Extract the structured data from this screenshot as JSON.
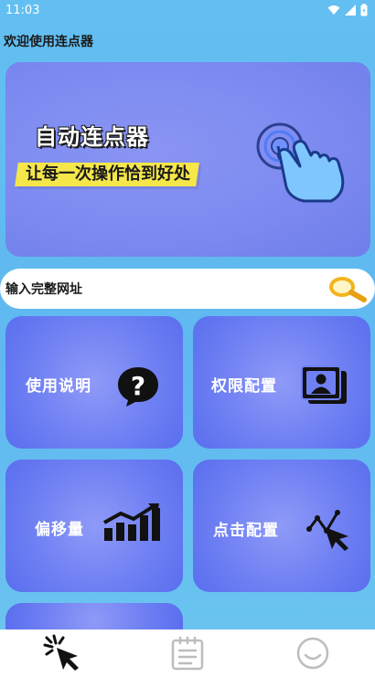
{
  "status_bar": {
    "time": "11:03"
  },
  "header": {
    "title": "欢迎使用连点器"
  },
  "banner": {
    "title": "自动连点器",
    "subtitle": "让每一次操作恰到好处"
  },
  "search": {
    "placeholder": "输入完整网址"
  },
  "cards": [
    {
      "label": "使用说明",
      "icon": "question-icon"
    },
    {
      "label": "权限配置",
      "icon": "profile-card-icon"
    },
    {
      "label": "偏移量",
      "icon": "bar-chart-icon"
    },
    {
      "label": "点击配置",
      "icon": "click-path-icon"
    }
  ],
  "bottom_nav": [
    {
      "icon": "click-cursor-icon",
      "active": true
    },
    {
      "icon": "notepad-icon",
      "active": false
    },
    {
      "icon": "smile-icon",
      "active": false
    }
  ],
  "colors": {
    "background": "#63bff1",
    "card": "#6f80f3",
    "banner_subtitle_bg": "#f5e74a"
  }
}
